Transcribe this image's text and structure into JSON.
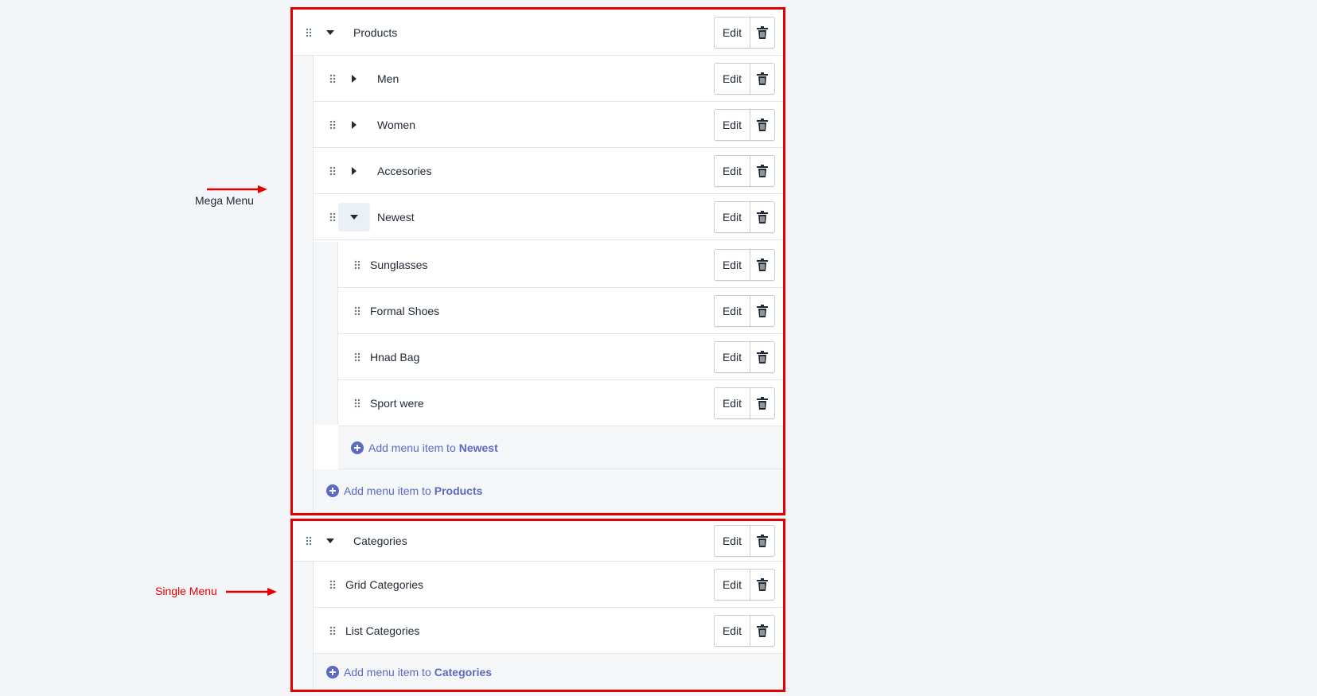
{
  "annotations": {
    "mega_label": "Mega Menu",
    "single_label": "Single Menu",
    "mega_color": "#212b36",
    "single_color": "#e50000"
  },
  "common": {
    "edit_label": "Edit",
    "add_prefix": "Add menu item to"
  },
  "colors": {
    "highlight_border": "#e50000",
    "accent": "#5c6ac4",
    "background": "#f4f5f8"
  },
  "products": {
    "label": "Products",
    "expanded": true,
    "children": [
      {
        "label": "Men",
        "expanded": false
      },
      {
        "label": "Women",
        "expanded": false
      },
      {
        "label": "Accesories",
        "expanded": false
      },
      {
        "label": "Newest",
        "expanded": true,
        "children": [
          {
            "label": "Sunglasses"
          },
          {
            "label": "Formal Shoes"
          },
          {
            "label": "Hnad Bag"
          },
          {
            "label": "Sport were"
          }
        ],
        "add_target": "Newest"
      }
    ],
    "add_target": "Products"
  },
  "categories": {
    "label": "Categories",
    "expanded": true,
    "children": [
      {
        "label": "Grid Categories"
      },
      {
        "label": "List Categories"
      }
    ],
    "add_target": "Categories"
  }
}
